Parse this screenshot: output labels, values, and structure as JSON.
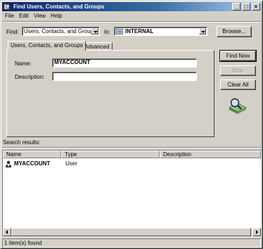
{
  "window": {
    "title": "Find Users, Contacts, and Groups",
    "controls": {
      "minimize": "_",
      "maximize": "□",
      "close": "×"
    }
  },
  "menu": [
    "File",
    "Edit",
    "View",
    "Help"
  ],
  "find": {
    "label": "Find:",
    "value": "Users, Contacts, and Groups",
    "in_label": "In:",
    "in_value": "INTERNAL",
    "browse_label": "Browse..."
  },
  "tabs": [
    "Users, Contacts, and Groups",
    "Advanced"
  ],
  "form": {
    "name_label": "Name:",
    "name_value": "MYACCOUNT",
    "description_label": "Description:",
    "description_value": ""
  },
  "buttons": {
    "find_now": "Find Now",
    "stop": "Stop",
    "clear_all": "Clear All"
  },
  "results": {
    "label": "Search results:",
    "columns": [
      "Name",
      "Type",
      "Description"
    ],
    "rows": [
      {
        "name": "MYACCOUNT",
        "type": "User",
        "description": ""
      }
    ]
  },
  "status": "1 item(s) found",
  "icons": {
    "title": "find-icon",
    "domain": "domain-icon",
    "search_animation": "search-magnifier-icon",
    "row": "user-icon"
  }
}
